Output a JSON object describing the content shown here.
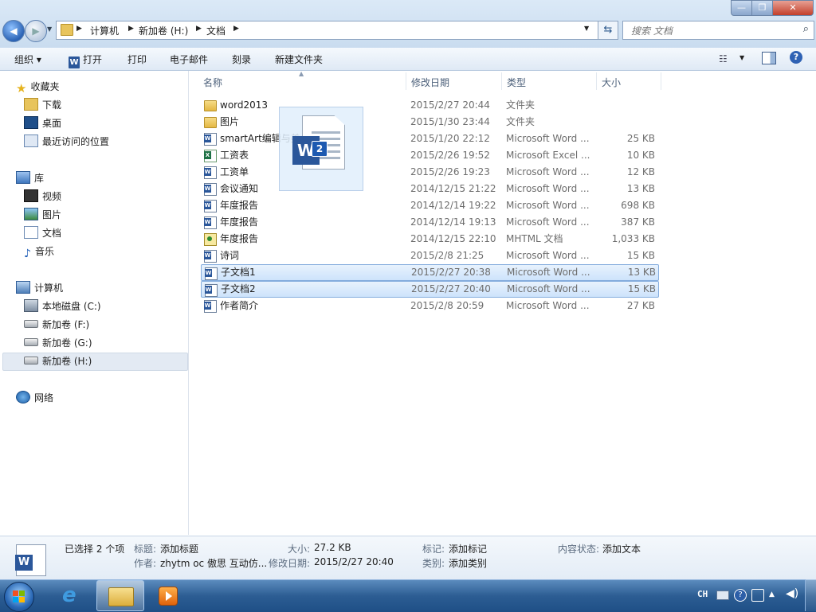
{
  "window": {
    "controls": {
      "minimize": "—",
      "maximize": "❐",
      "close": "✕"
    }
  },
  "address": {
    "breadcrumbs": [
      "计算机",
      "新加卷 (H:)",
      "文档"
    ],
    "search_placeholder": "搜索 文档"
  },
  "toolbar": {
    "organize": "组织 ▾",
    "open": "打开",
    "print": "打印",
    "email": "电子邮件",
    "burn": "刻录",
    "new_folder": "新建文件夹"
  },
  "nav": {
    "favorites": "收藏夹",
    "downloads": "下载",
    "desktop": "桌面",
    "recent": "最近访问的位置",
    "libraries": "库",
    "videos": "视频",
    "pictures": "图片",
    "documents": "文档",
    "music": "音乐",
    "computer": "计算机",
    "drive_c": "本地磁盘 (C:)",
    "drive_f": "新加卷 (F:)",
    "drive_g": "新加卷 (G:)",
    "drive_h": "新加卷 (H:)",
    "network": "网络"
  },
  "columns": {
    "name": "名称",
    "date": "修改日期",
    "type": "类型",
    "size": "大小"
  },
  "files": [
    {
      "name": "word2013",
      "date": "2015/2/27 20:44",
      "type": "文件夹",
      "size": "",
      "icon": "folder-icon"
    },
    {
      "name": "图片",
      "date": "2015/1/30 23:44",
      "type": "文件夹",
      "size": "",
      "icon": "folder-icon"
    },
    {
      "name": "smartArt编辑与美化",
      "date": "2015/1/20 22:12",
      "type": "Microsoft Word ...",
      "size": "25 KB",
      "icon": "word-doc-icon"
    },
    {
      "name": "工资表",
      "date": "2015/2/26 19:52",
      "type": "Microsoft Excel ...",
      "size": "10 KB",
      "icon": "excel-doc-icon"
    },
    {
      "name": "工资单",
      "date": "2015/2/26 19:23",
      "type": "Microsoft Word ...",
      "size": "12 KB",
      "icon": "word-doc-icon"
    },
    {
      "name": "会议通知",
      "date": "2014/12/15 21:22",
      "type": "Microsoft Word ...",
      "size": "13 KB",
      "icon": "word-doc-icon"
    },
    {
      "name": "年度报告",
      "date": "2014/12/14 19:22",
      "type": "Microsoft Word ...",
      "size": "698 KB",
      "icon": "word-doc-icon"
    },
    {
      "name": "年度报告",
      "date": "2014/12/14 19:13",
      "type": "Microsoft Word ...",
      "size": "387 KB",
      "icon": "word-doc-icon"
    },
    {
      "name": "年度报告",
      "date": "2014/12/15 22:10",
      "type": "MHTML 文档",
      "size": "1,033 KB",
      "icon": "mhtml-doc-icon"
    },
    {
      "name": "诗词",
      "date": "2015/2/8 21:25",
      "type": "Microsoft Word ...",
      "size": "15 KB",
      "icon": "word-doc-icon"
    },
    {
      "name": "子文档1",
      "date": "2015/2/27 20:38",
      "type": "Microsoft Word ...",
      "size": "13 KB",
      "icon": "word-doc-icon",
      "selected": true
    },
    {
      "name": "子文档2",
      "date": "2015/2/27 20:40",
      "type": "Microsoft Word ...",
      "size": "15 KB",
      "icon": "word-doc-icon",
      "selected": true
    },
    {
      "name": "作者简介",
      "date": "2015/2/8 20:59",
      "type": "Microsoft Word ...",
      "size": "27 KB",
      "icon": "word-doc-icon"
    }
  ],
  "drag_ghost": {
    "count": "2",
    "icon": "word-doc-icon"
  },
  "details": {
    "selected_count": "已选择 2 个项",
    "title_key": "标题:",
    "title_val": "添加标题",
    "author_key": "作者:",
    "author_val": "zhytm oc 傲思  互动仿...",
    "size_key": "大小:",
    "size_val": "27.2 KB",
    "modified_key": "修改日期:",
    "modified_val": "2015/2/27 20:40",
    "tags_key": "标记:",
    "tags_val": "添加标记",
    "category_key": "类别:",
    "category_val": "添加类别",
    "content_key": "内容状态:",
    "content_val": "添加文本"
  },
  "taskbar": {
    "lang": "CH"
  },
  "colors": {
    "accent": "#2b579a",
    "selection": "#cde3fb",
    "taskbar": "#2c5d93"
  }
}
